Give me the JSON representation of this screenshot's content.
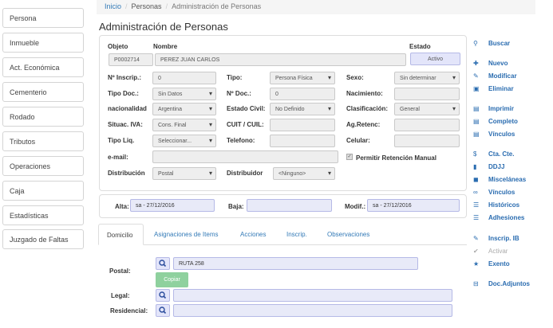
{
  "sidebar": {
    "items": [
      {
        "label": "Persona"
      },
      {
        "label": "Inmueble"
      },
      {
        "label": "Act. Económica"
      },
      {
        "label": "Cementerio"
      },
      {
        "label": "Rodado"
      },
      {
        "label": "Tributos"
      },
      {
        "label": "Operaciones"
      },
      {
        "label": "Caja"
      },
      {
        "label": "Estadísticas"
      },
      {
        "label": "Juzgado de Faltas"
      }
    ]
  },
  "breadcrumb": {
    "home": "Inicio",
    "section": "Personas",
    "current": "Administración de Personas"
  },
  "page": {
    "title": "Administración de Personas"
  },
  "form": {
    "objeto": {
      "label": "Objeto",
      "value": "P0002714"
    },
    "nombre": {
      "label": "Nombre",
      "value": "PEREZ JUAN CARLOS"
    },
    "estado": {
      "label": "Estado",
      "value": "Activo"
    },
    "inscrip": {
      "label": "Nº Inscrip.:",
      "value": "0"
    },
    "tipo": {
      "label": "Tipo:",
      "value": "Persona Física"
    },
    "sexo": {
      "label": "Sexo:",
      "value": "Sin determinar"
    },
    "tipo_doc": {
      "label": "Tipo Doc.:",
      "value": "Sin Datos"
    },
    "nro_doc": {
      "label": "Nº Doc.:",
      "value": "0"
    },
    "nacimiento": {
      "label": "Nacimiento:",
      "value": ""
    },
    "nacionalidad": {
      "label": "nacionalidad",
      "value": "Argentina"
    },
    "estado_civil": {
      "label": "Estado Civil:",
      "value": "No Definido"
    },
    "clasificacion": {
      "label": "Clasificación:",
      "value": "General"
    },
    "situac_iva": {
      "label": "Situac. IVA:",
      "value": "Cons. Final"
    },
    "cuit": {
      "label": "CUIT / CUIL:",
      "value": ""
    },
    "ag_retenc": {
      "label": "Ag.Retenc:",
      "value": ""
    },
    "tipo_liq": {
      "label": "Tipo Liq.",
      "value": "Seleccionar..."
    },
    "telefono": {
      "label": "Telefono:",
      "value": ""
    },
    "celular": {
      "label": "Celular:",
      "value": ""
    },
    "email": {
      "label": "e-mail:",
      "value": ""
    },
    "permitir_retencion": {
      "label": "Permitir Retención Manual",
      "checked": true
    },
    "distribucion": {
      "label": "Distribución",
      "value": "Postal"
    },
    "distribuidor": {
      "label": "Distribuidor",
      "value": "<Ninguno>"
    }
  },
  "dates": {
    "alta": {
      "label": "Alta:",
      "value": "sa - 27/12/2016"
    },
    "baja": {
      "label": "Baja:",
      "value": ""
    },
    "modif": {
      "label": "Modif.:",
      "value": "sa - 27/12/2016"
    }
  },
  "tabs": [
    {
      "label": "Domicilio",
      "active": true
    },
    {
      "label": "Asignaciones de Items"
    },
    {
      "label": "Acciones"
    },
    {
      "label": "Inscrip."
    },
    {
      "label": "Observaciones"
    }
  ],
  "domicilio": {
    "postal": {
      "label": "Postal:",
      "value": "RUTA 258"
    },
    "copy_label": "Copiar",
    "legal": {
      "label": "Legal:",
      "value": ""
    },
    "residencial": {
      "label": "Residencial:",
      "value": ""
    }
  },
  "actions": [
    {
      "label": "Buscar",
      "icon": "search-icon"
    },
    {
      "label": "Nuevo",
      "icon": "plus-icon"
    },
    {
      "label": "Modificar",
      "icon": "pencil-icon"
    },
    {
      "label": "Eliminar",
      "icon": "trash-icon"
    },
    {
      "label": "Imprimir",
      "icon": "print-icon"
    },
    {
      "label": "Completo",
      "icon": "print-icon"
    },
    {
      "label": "Vínculos",
      "icon": "print-icon"
    },
    {
      "label": "Cta. Cte.",
      "icon": "dollar-icon"
    },
    {
      "label": "DDJJ",
      "icon": "book-icon"
    },
    {
      "label": "Misceláneas",
      "icon": "comment-icon"
    },
    {
      "label": "Vínculos",
      "icon": "link-icon"
    },
    {
      "label": "Históricos",
      "icon": "list-icon"
    },
    {
      "label": "Adhesiones",
      "icon": "list-icon"
    },
    {
      "label": "Inscrip. IB",
      "icon": "pencil-icon"
    },
    {
      "label": "Activar",
      "icon": "check-icon",
      "disabled": true
    },
    {
      "label": "Exento",
      "icon": "star-icon"
    },
    {
      "label": "Doc.Adjuntos",
      "icon": "archive-icon"
    }
  ]
}
